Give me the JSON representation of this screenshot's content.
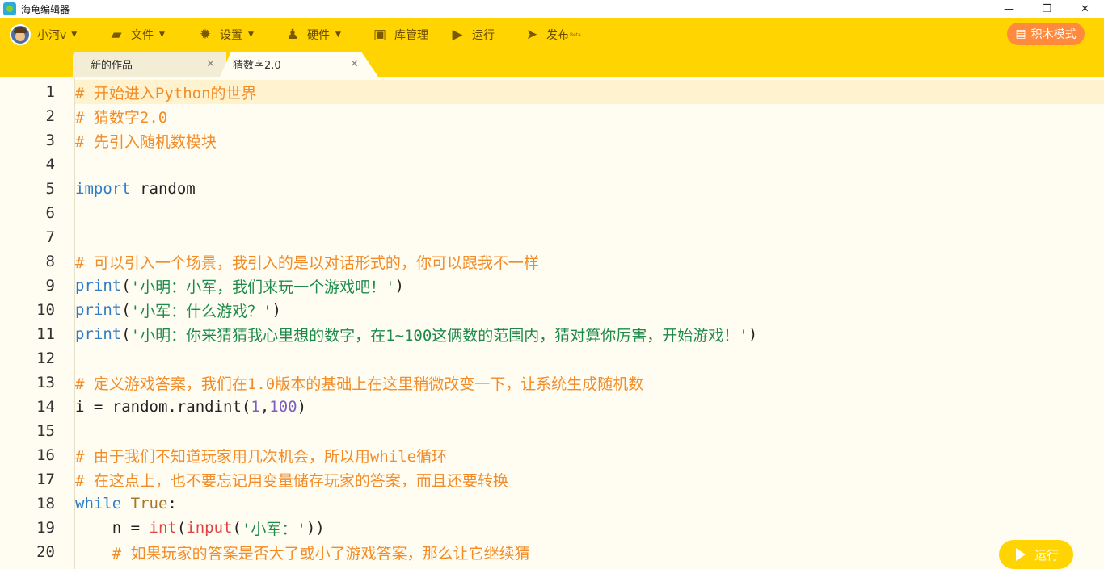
{
  "window": {
    "title": "海龟编辑器",
    "controls": {
      "minimize": "—",
      "restore": "❐",
      "close": "✕"
    }
  },
  "toolbar": {
    "user_name": "小河v",
    "menus": [
      {
        "icon": "folder-icon",
        "glyph": "▰",
        "label": "文件",
        "caret": true
      },
      {
        "icon": "gear-icon",
        "glyph": "✹",
        "label": "设置",
        "caret": true
      },
      {
        "icon": "robot-icon",
        "glyph": "♟",
        "label": "硬件",
        "caret": true
      },
      {
        "icon": "library-icon",
        "glyph": "▣",
        "label": "库管理",
        "caret": false
      },
      {
        "icon": "play-circle-icon",
        "glyph": "▶",
        "label": "运行",
        "caret": false
      },
      {
        "icon": "send-icon",
        "glyph": "➤",
        "label": "发布",
        "caret": false
      }
    ],
    "publish_badge": "Beta",
    "block_mode_label": "积木模式",
    "block_mode_icon": "blocks-icon"
  },
  "tabs": [
    {
      "label": "新的作品",
      "active": false
    },
    {
      "label": "猜数字2.0",
      "active": true
    }
  ],
  "editor": {
    "lines": [
      [
        {
          "t": "cmt",
          "v": "# 开始进入Python的世界"
        }
      ],
      [
        {
          "t": "cmt",
          "v": "# 猜数字2.0"
        }
      ],
      [
        {
          "t": "cmt",
          "v": "# 先引入随机数模块"
        }
      ],
      [],
      [
        {
          "t": "kw",
          "v": "import"
        },
        {
          "t": "plain",
          "v": " random"
        }
      ],
      [],
      [],
      [
        {
          "t": "cmt",
          "v": "# 可以引入一个场景，我引入的是以对话形式的，你可以跟我不一样"
        }
      ],
      [
        {
          "t": "fn",
          "v": "print"
        },
        {
          "t": "plain",
          "v": "("
        },
        {
          "t": "str",
          "v": "'小明：小军，我们来玩一个游戏吧！'"
        },
        {
          "t": "plain",
          "v": ")"
        }
      ],
      [
        {
          "t": "fn",
          "v": "print"
        },
        {
          "t": "plain",
          "v": "("
        },
        {
          "t": "str",
          "v": "'小军：什么游戏？'"
        },
        {
          "t": "plain",
          "v": ")"
        }
      ],
      [
        {
          "t": "fn",
          "v": "print"
        },
        {
          "t": "plain",
          "v": "("
        },
        {
          "t": "str",
          "v": "'小明：你来猜猜我心里想的数字，在1~100这俩数的范围内，猜对算你厉害，开始游戏！'"
        },
        {
          "t": "plain",
          "v": ")"
        }
      ],
      [],
      [
        {
          "t": "cmt",
          "v": "# 定义游戏答案，我们在1.0版本的基础上在这里稍微改变一下，让系统生成随机数"
        }
      ],
      [
        {
          "t": "plain",
          "v": "i = random.randint("
        },
        {
          "t": "num",
          "v": "1"
        },
        {
          "t": "plain",
          "v": ","
        },
        {
          "t": "num",
          "v": "100"
        },
        {
          "t": "plain",
          "v": ")"
        }
      ],
      [],
      [
        {
          "t": "cmt",
          "v": "# 由于我们不知道玩家用几次机会，所以用while循环"
        }
      ],
      [
        {
          "t": "cmt",
          "v": "# 在这点上，也不要忘记用变量储存玩家的答案，而且还要转换"
        }
      ],
      [
        {
          "t": "kw",
          "v": "while"
        },
        {
          "t": "plain",
          "v": " "
        },
        {
          "t": "tru",
          "v": "True"
        },
        {
          "t": "plain",
          "v": ":"
        }
      ],
      [
        {
          "t": "plain",
          "v": "    n = "
        },
        {
          "t": "bi",
          "v": "int"
        },
        {
          "t": "plain",
          "v": "("
        },
        {
          "t": "bi",
          "v": "input"
        },
        {
          "t": "plain",
          "v": "("
        },
        {
          "t": "str",
          "v": "'小军：'"
        },
        {
          "t": "plain",
          "v": "))"
        }
      ],
      [
        {
          "t": "cmt",
          "v": "    # 如果玩家的答案是否大了或小了游戏答案，那么让它继续猜"
        }
      ]
    ]
  },
  "run_button": {
    "label": "运行"
  },
  "colors": {
    "toolbar_bg": "#ffd400",
    "comment": "#f28c28",
    "keyword": "#2f7cc5",
    "string": "#1e8a4a",
    "number": "#7a5ec0",
    "accent_button": "#ff8a3d"
  }
}
